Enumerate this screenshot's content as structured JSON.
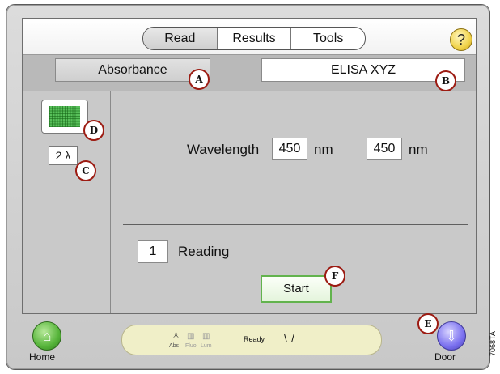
{
  "tabs": [
    "Read",
    "Results",
    "Tools"
  ],
  "help_label": "?",
  "mode": {
    "measurement": "Absorbance",
    "protocol_name": "ELISA XYZ"
  },
  "wavelength": {
    "label": "Wavelength",
    "value1": "450",
    "unit1": "nm",
    "value2": "450",
    "unit2": "nm"
  },
  "left_panel": {
    "wavelength_count": "2 λ"
  },
  "reading": {
    "count": "1",
    "label": "Reading"
  },
  "start_label": "Start",
  "bottom_bar": {
    "home_label": "Home",
    "door_label": "Door",
    "status_text": "Ready",
    "icons": [
      "Abs",
      "Fluo",
      "Lum"
    ]
  },
  "callouts": [
    "A",
    "B",
    "C",
    "D",
    "E",
    "F"
  ],
  "figure_code": "7068TA",
  "colors": {
    "accent_green": "#62b34d",
    "callout_red": "#9c1b12",
    "help_yellow": "#f1d34a",
    "door_purple": "#7a70ef"
  }
}
